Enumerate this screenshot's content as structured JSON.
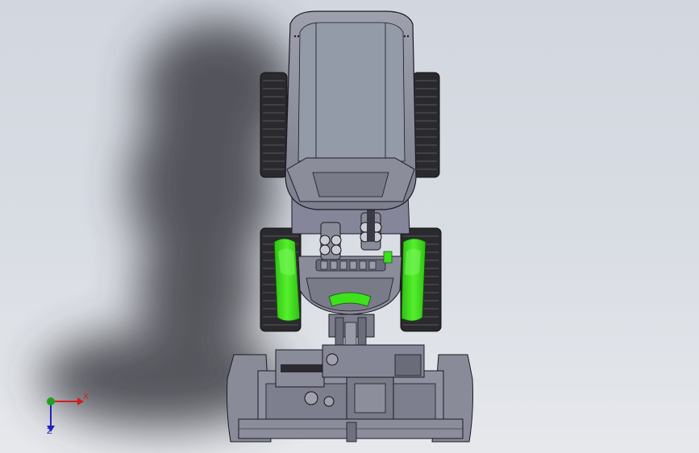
{
  "viewport": {
    "background_top": "#d2d7df",
    "background_bottom": "#e6e8ec"
  },
  "model": {
    "body_color": "#8b8c9a",
    "edge_color": "#1a1a24",
    "accent_color": "#3de11c",
    "tire_color": "#2a2a2e",
    "shadow_color": "#3c3c44"
  },
  "triad": {
    "x_label": "X",
    "z_label": "Z",
    "x_color": "#d02020",
    "y_color": "#20a020",
    "z_color": "#2020c0"
  }
}
